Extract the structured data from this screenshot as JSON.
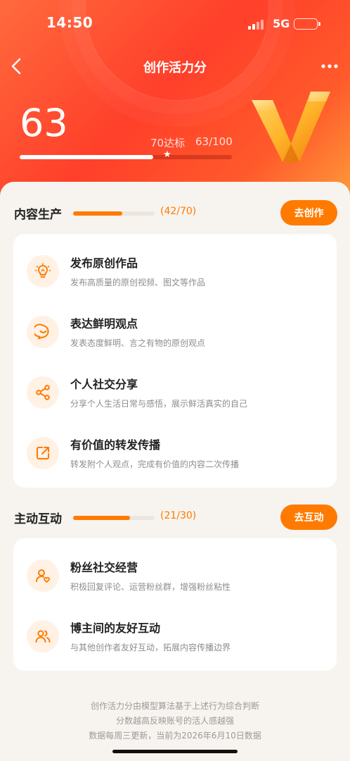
{
  "status_bar": {
    "time": "14:50",
    "network": "5G"
  },
  "nav": {
    "title": "创作活力分",
    "back_icon": "chevron-left-icon",
    "more_icon": "more-dots-icon"
  },
  "score": {
    "value": "63",
    "goal_label": "70达标",
    "ratio": "63/100",
    "progress": 0.63,
    "goal_mark": 0.7
  },
  "sections": [
    {
      "title": "内容生产",
      "count": "(42/70)",
      "progress": 0.6,
      "button": "去创作",
      "items": [
        {
          "icon": "lightbulb-icon",
          "title": "发布原创作品",
          "desc": "发布高质量的原创视频、图文等作品"
        },
        {
          "icon": "chat-bubble-icon",
          "title": "表达鲜明观点",
          "desc": "发表态度鲜明、言之有物的原创观点"
        },
        {
          "icon": "share-icon",
          "title": "个人社交分享",
          "desc": "分享个人生活日常与感悟，展示鲜活真实的自己"
        },
        {
          "icon": "repost-icon",
          "title": "有价值的转发传播",
          "desc": "转发附个人观点，完成有价值的内容二次传播"
        }
      ]
    },
    {
      "title": "主动互动",
      "count": "(21/30)",
      "progress": 0.7,
      "button": "去互动",
      "items": [
        {
          "icon": "fan-heart-icon",
          "title": "粉丝社交经营",
          "desc": "积极回复评论、运营粉丝群，增强粉丝粘性"
        },
        {
          "icon": "users-icon",
          "title": "博主间的友好互动",
          "desc": "与其他创作者友好互动，拓展内容传播边界"
        }
      ]
    }
  ],
  "footer": {
    "line1": "创作活力分由模型算法基于上述行为综合判断",
    "line2": "分数越高反映账号的活人感越强",
    "line3": "数据每周三更新，当前为2026年6月10日数据"
  },
  "colors": {
    "accent": "#ff7a00",
    "hero_red": "#ff3f2a",
    "icon_bg": "#fff1e4"
  }
}
